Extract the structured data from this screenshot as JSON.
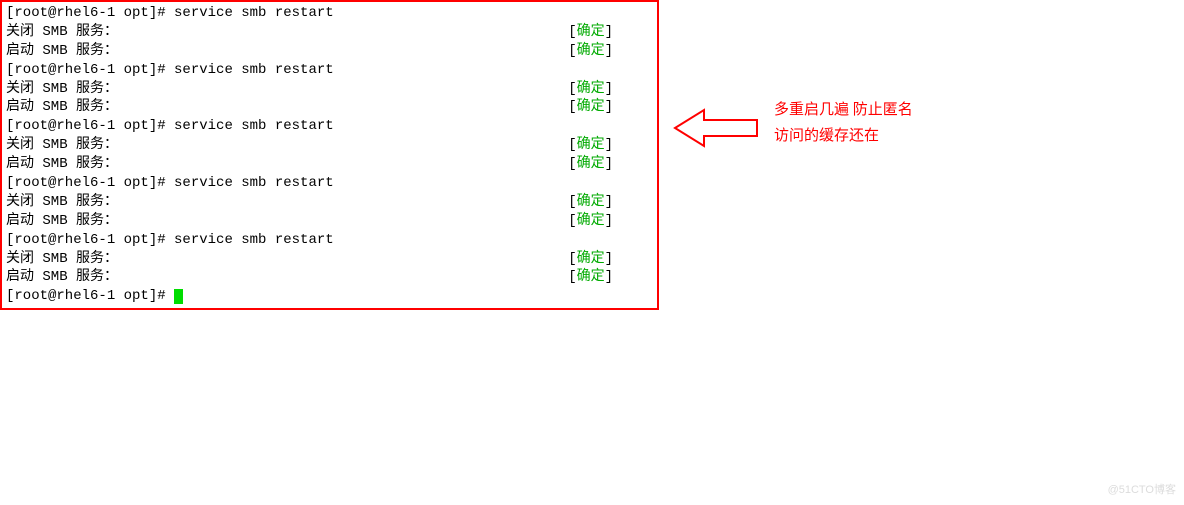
{
  "terminal": {
    "prompt": "[root@rhel6-1 opt]# ",
    "command": "service smb restart",
    "close_label": "关闭 SMB 服务：",
    "start_label": "启动 SMB 服务：",
    "status_open": "[",
    "status_text": "确定",
    "status_close": "]",
    "repeats": 5
  },
  "annotation": {
    "line1": "多重启几遍 防止匿名",
    "line2": "访问的缓存还在"
  },
  "watermark": "@51CTO博客"
}
